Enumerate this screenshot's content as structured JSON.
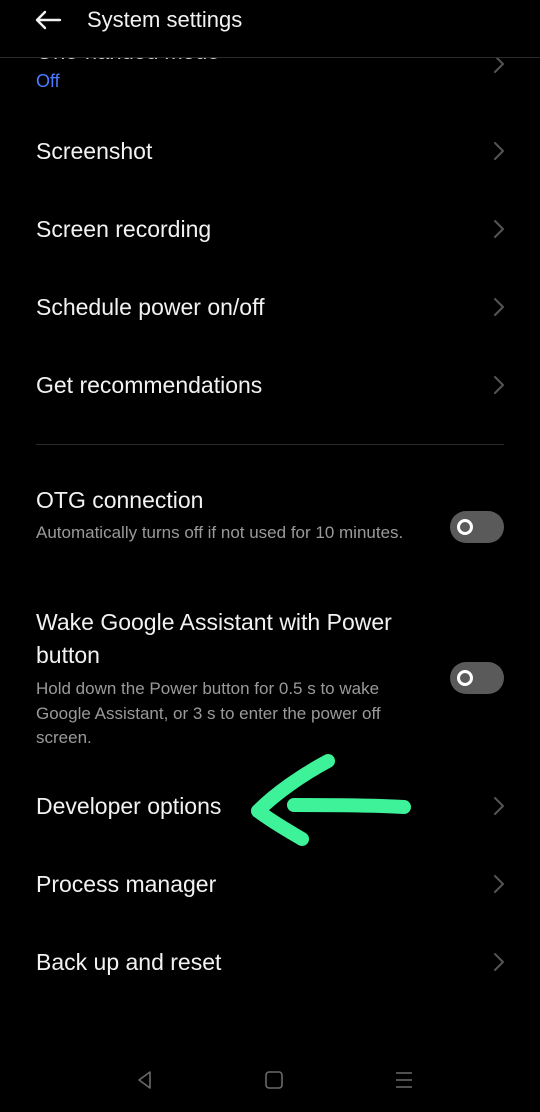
{
  "header": {
    "title": "System settings",
    "back_icon": "back-arrow-icon"
  },
  "clipped_item": {
    "title": "One-handed mode",
    "value": "Off",
    "value_color": "#4e7bff"
  },
  "rows": [
    {
      "label": "Screenshot"
    },
    {
      "label": "Screen recording"
    },
    {
      "label": "Schedule power on/off"
    },
    {
      "label": "Get recommendations"
    }
  ],
  "toggles": [
    {
      "title": "OTG connection",
      "description": "Automatically turns off if not used for 10 minutes.",
      "enabled": false
    },
    {
      "title": "Wake Google Assistant with Power button",
      "description": "Hold down the Power button for 0.5 s to wake Google Assistant, or 3 s to enter the power off screen.",
      "enabled": false
    }
  ],
  "rows2": [
    {
      "label": "Developer options"
    },
    {
      "label": "Process manager"
    },
    {
      "label": "Back up and reset"
    }
  ],
  "annotation": {
    "type": "arrow",
    "color": "#3ef29a"
  },
  "navbar": {
    "back": "nav-back-icon",
    "home": "nav-home-icon",
    "recents": "nav-recents-icon"
  }
}
